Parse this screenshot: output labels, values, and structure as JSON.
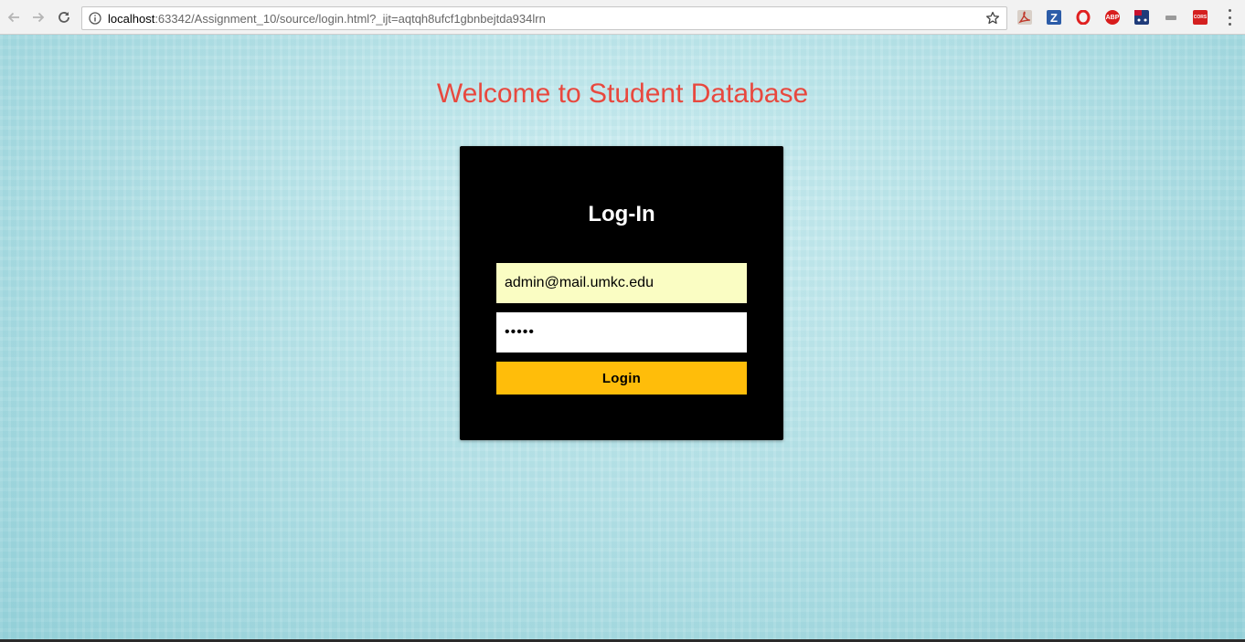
{
  "browser": {
    "url_host": "localhost",
    "url_rest": ":63342/Assignment_10/source/login.html?_ijt=aqtqh8ufcf1gbnbejtda934lrn",
    "extensions": [
      {
        "name": "acrobat-extension-icon",
        "color": "#c0392b"
      },
      {
        "name": "zotero-extension-icon",
        "color": "#2c5ca8",
        "glyph": "Z"
      },
      {
        "name": "opera-extension-icon",
        "color": "#e02020"
      },
      {
        "name": "adblock-plus-extension-icon",
        "color": "#d81c1c",
        "glyph": "ABP"
      },
      {
        "name": "flag-extension-icon",
        "color": "#1f3b7a"
      },
      {
        "name": "generic-extension-icon",
        "color": "#8a8a8a"
      },
      {
        "name": "cors-extension-icon",
        "color": "#d42020",
        "glyph": "CORS"
      }
    ]
  },
  "page": {
    "title": "Welcome to Student Database",
    "title_color": "#e8483e",
    "login": {
      "heading": "Log-In",
      "email_value": "admin@mail.umkc.edu",
      "password_value": "•••••",
      "button_label": "Login",
      "button_color": "#ffbd0a"
    }
  }
}
